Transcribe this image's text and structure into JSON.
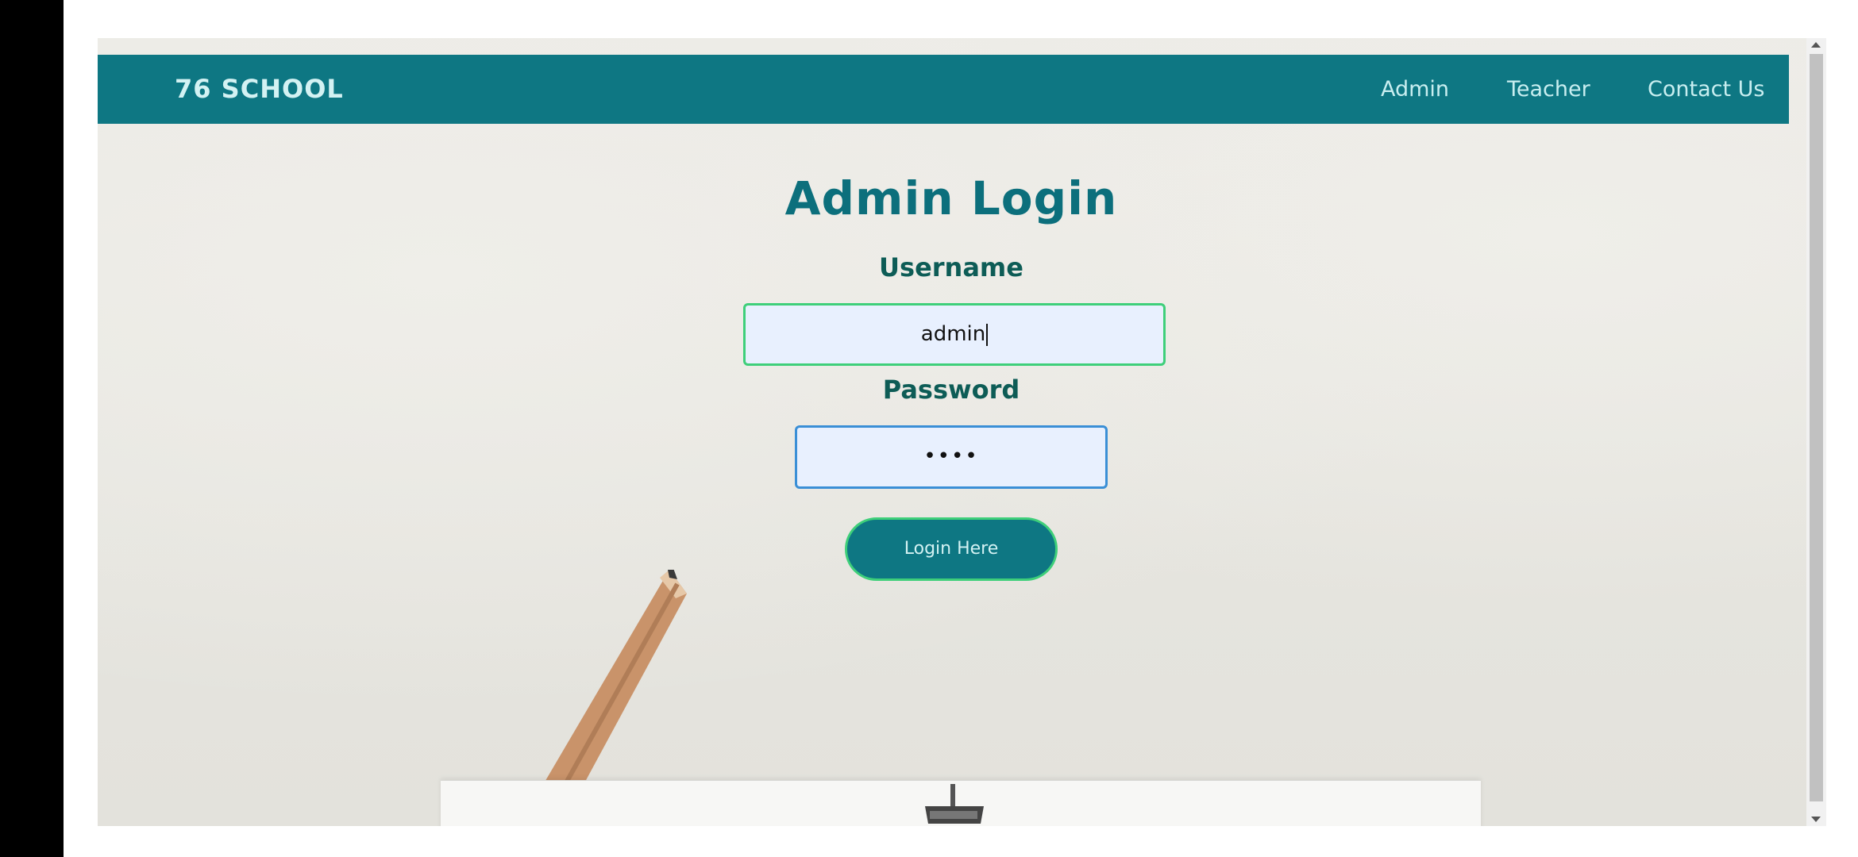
{
  "navbar": {
    "brand": "76 SCHOOL",
    "links": [
      "Admin",
      "Teacher",
      "Contact Us"
    ]
  },
  "login": {
    "title": "Admin Login",
    "username_label": "Username",
    "username_value": "admin",
    "password_label": "Password",
    "password_value": "••••",
    "button_label": "Login Here"
  },
  "colors": {
    "navbar_bg": "#0e7783",
    "title": "#0c6f7c",
    "label": "#0d5c56",
    "input_bg": "#e8f0fe",
    "focus_border": "#3ecf7a",
    "input_border": "#3a8fd6"
  },
  "icons": {
    "pencil": "pencil-icon",
    "binder_clip": "binder-clip-icon"
  }
}
